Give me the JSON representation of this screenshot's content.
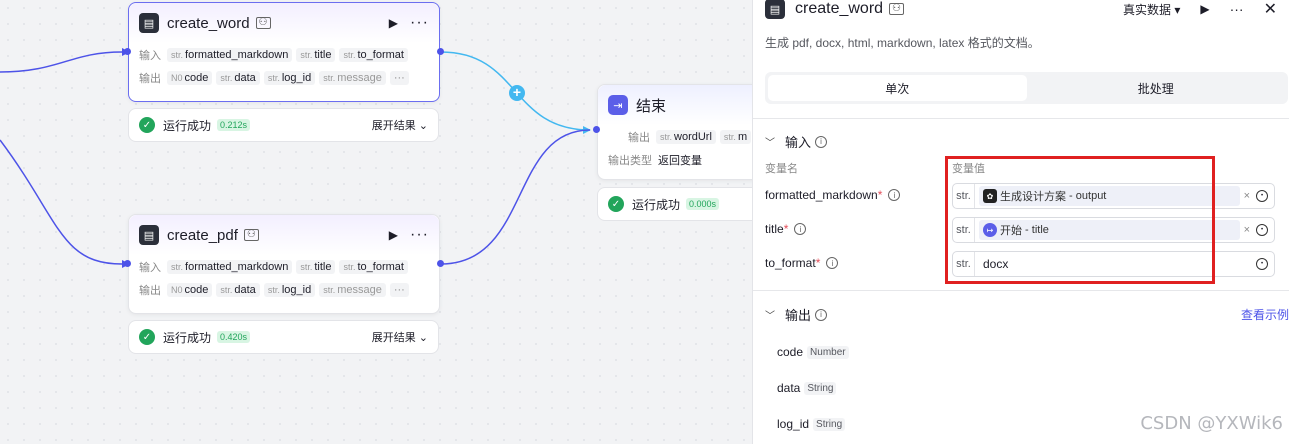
{
  "nodes": {
    "create_word": {
      "title": "create_word",
      "input_label": "输入",
      "output_label": "输出",
      "inputs": [
        {
          "type": "str.",
          "name": "formatted_markdown"
        },
        {
          "type": "str.",
          "name": "title"
        },
        {
          "type": "str.",
          "name": "to_format"
        }
      ],
      "outputs": [
        {
          "type": "N0",
          "name": "code"
        },
        {
          "type": "str.",
          "name": "data"
        },
        {
          "type": "str.",
          "name": "log_id"
        },
        {
          "type": "str.",
          "name": "message"
        }
      ],
      "more": "···",
      "status": "运行成功",
      "time": "0.212s",
      "expand": "展开结果"
    },
    "create_pdf": {
      "title": "create_pdf",
      "input_label": "输入",
      "output_label": "输出",
      "inputs": [
        {
          "type": "str.",
          "name": "formatted_markdown"
        },
        {
          "type": "str.",
          "name": "title"
        },
        {
          "type": "str.",
          "name": "to_format"
        }
      ],
      "outputs": [
        {
          "type": "N0",
          "name": "code"
        },
        {
          "type": "str.",
          "name": "data"
        },
        {
          "type": "str.",
          "name": "log_id"
        },
        {
          "type": "str.",
          "name": "message"
        }
      ],
      "more": "···",
      "status": "运行成功",
      "time": "0.420s",
      "expand": "展开结果"
    },
    "end": {
      "title": "结束",
      "output_label": "输出",
      "output_type_label": "输出类型",
      "output_type_value": "返回变量",
      "outputs": [
        {
          "type": "str.",
          "name": "wordUrl"
        },
        {
          "type": "str.",
          "name": "m"
        }
      ],
      "status": "运行成功",
      "time": "0.000s"
    }
  },
  "panel": {
    "title": "create_word",
    "data_mode": "真实数据",
    "description": "生成 pdf, docx, html, markdown, latex 格式的文档。",
    "tabs": [
      "单次",
      "批处理"
    ],
    "input_section": "输入",
    "col_name": "变量名",
    "col_value": "变量值",
    "fields": [
      {
        "name": "formatted_markdown",
        "type": "str.",
        "ref_node": "生成设计方案",
        "ref_sep": " - ",
        "ref_var": "output",
        "clear": "×"
      },
      {
        "name": "title",
        "type": "str.",
        "ref_node": "开始",
        "ref_sep": " - ",
        "ref_var": "title",
        "clear": "×"
      },
      {
        "name": "to_format",
        "type": "str.",
        "value": "docx"
      }
    ],
    "required_mark": "*",
    "output_section": "输出",
    "view_example": "查看示例",
    "outputs": [
      {
        "name": "code",
        "type": "Number"
      },
      {
        "name": "data",
        "type": "String"
      },
      {
        "name": "log_id",
        "type": "String"
      }
    ]
  },
  "watermark": "CSDN @YXWik6",
  "colors": {
    "accent": "#4d53e8",
    "edge_highlight": "#43b8f0",
    "success": "#22a55b",
    "annotation": "#e02020"
  }
}
